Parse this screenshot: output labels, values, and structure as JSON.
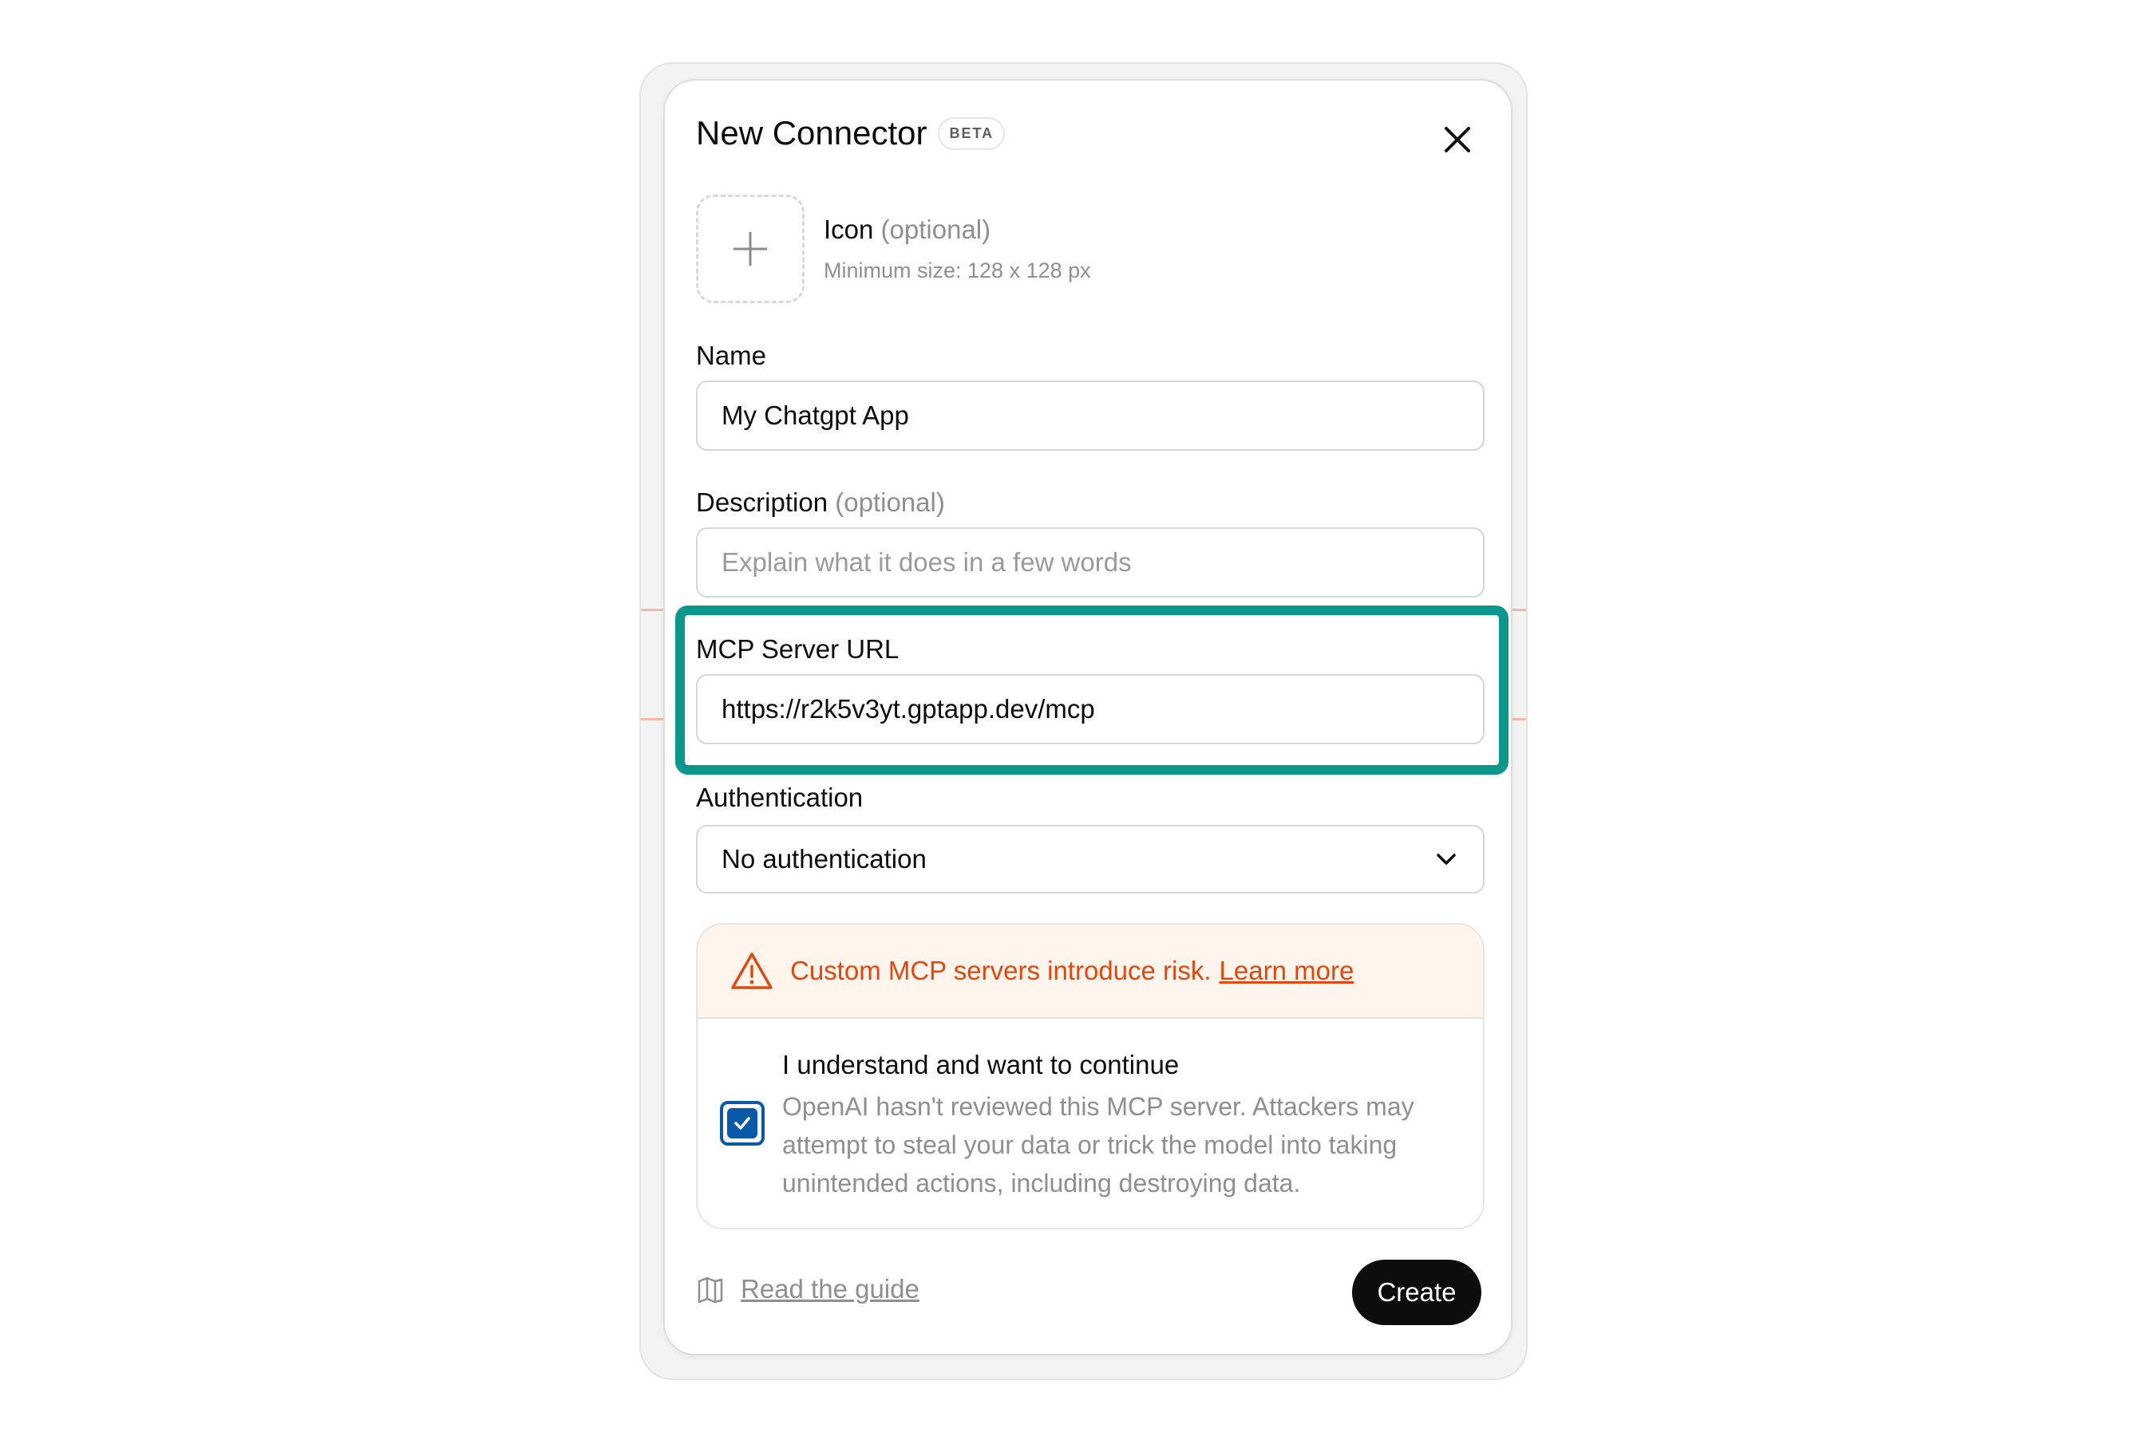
{
  "dialog": {
    "title": "New Connector",
    "badge": "BETA"
  },
  "icon_upload": {
    "label": "Icon",
    "optional": "(optional)",
    "hint": "Minimum size: 128 x 128 px"
  },
  "name_field": {
    "label": "Name",
    "value": "My Chatgpt App"
  },
  "description_field": {
    "label": "Description",
    "optional": "(optional)",
    "placeholder": "Explain what it does in a few words"
  },
  "url_field": {
    "label": "MCP Server URL",
    "value": "https://r2k5v3yt.gptapp.dev/mcp"
  },
  "auth_field": {
    "label": "Authentication",
    "selected": "No authentication"
  },
  "risk": {
    "message": "Custom MCP servers introduce risk.",
    "link": "Learn more",
    "ack_title": "I understand and want to continue",
    "ack_body": "OpenAI hasn't reviewed this MCP server. Attackers may attempt to steal your data or trick the model into taking unintended actions, including destroying data.",
    "checked": true
  },
  "footer": {
    "guide_link": "Read the guide",
    "create_label": "Create"
  },
  "colors": {
    "highlight": "#0b978c",
    "warning": "#e0480f",
    "checkbox": "#0a58a8",
    "primary_button": "#0d0d0d"
  },
  "icons": [
    "close-icon",
    "plus-icon",
    "chevron-down-icon",
    "warning-icon",
    "check-icon",
    "book-icon"
  ]
}
